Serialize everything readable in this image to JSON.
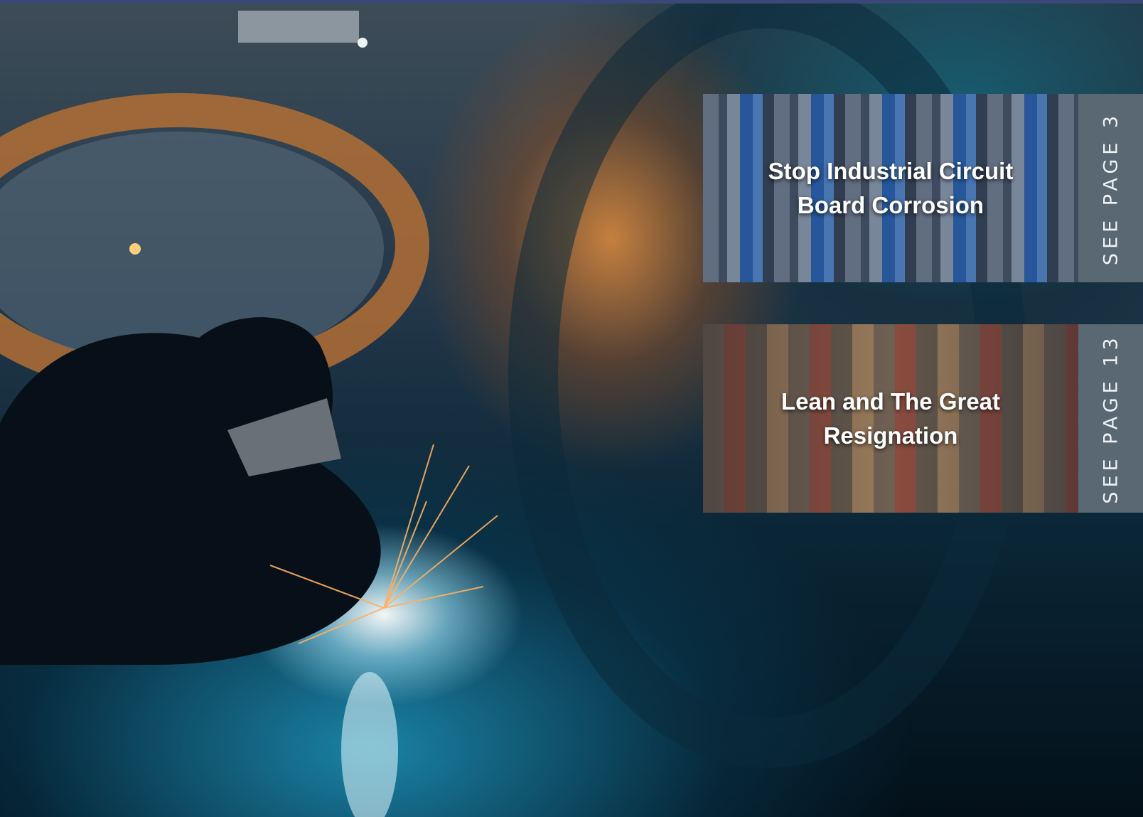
{
  "features": [
    {
      "title": "Stop Industrial Circuit Board Corrosion",
      "page_ref": "SEE PAGE 3"
    },
    {
      "title": "Lean and The Great Resignation",
      "page_ref": "SEE PAGE 13"
    }
  ],
  "colors": {
    "top_bar": "#3a4878",
    "side_tab": "#5a6873",
    "title_text": "#ffffff"
  }
}
